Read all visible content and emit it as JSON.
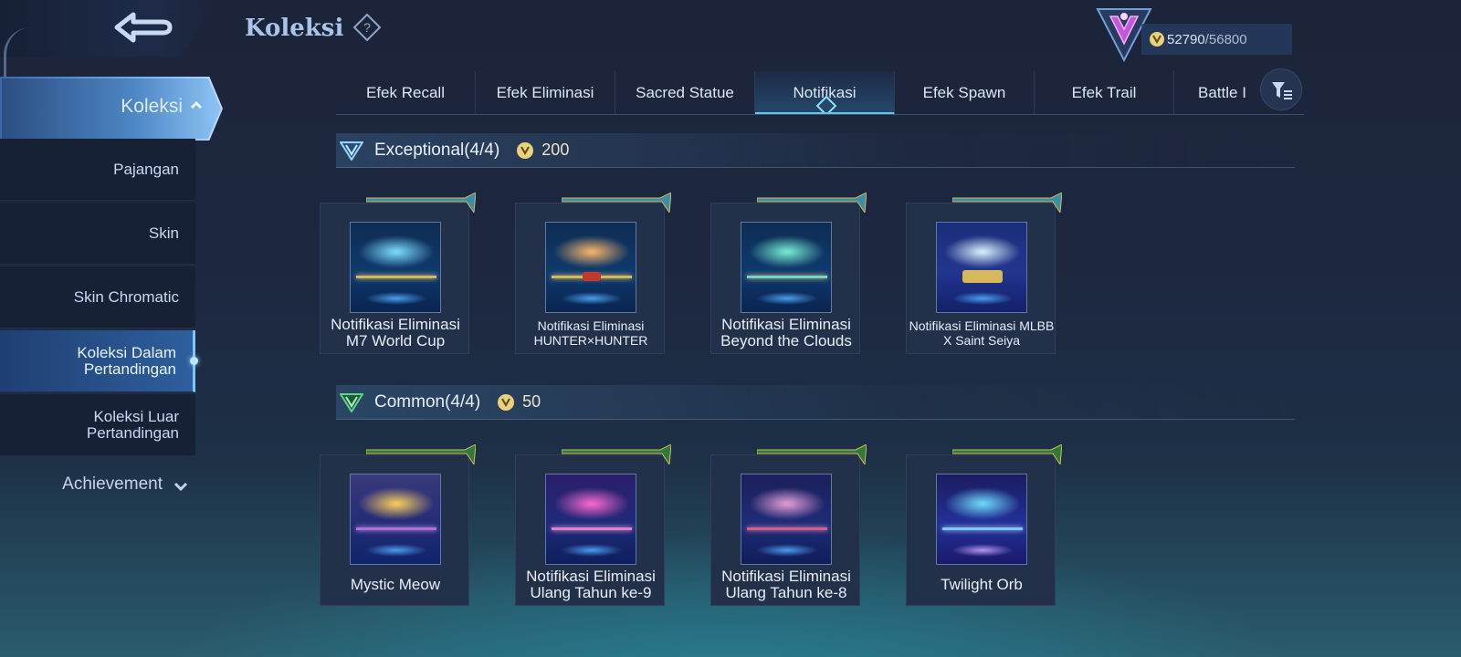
{
  "header": {
    "title": "Koleksi",
    "currency_current": "52790",
    "currency_separator": "/",
    "currency_max": "56800"
  },
  "sidebar": {
    "main_label": "Koleksi",
    "items": [
      {
        "label": "Pajangan"
      },
      {
        "label": "Skin"
      },
      {
        "label": "Skin Chromatic"
      },
      {
        "label": "Koleksi Dalam Pertandingan",
        "active": true
      },
      {
        "label": "Koleksi Luar Pertandingan"
      }
    ],
    "achievement_label": "Achievement"
  },
  "tabs": [
    {
      "label": "Efek Recall"
    },
    {
      "label": "Efek Eliminasi"
    },
    {
      "label": "Sacred Statue"
    },
    {
      "label": "Notifikasi",
      "active": true
    },
    {
      "label": "Efek Spawn"
    },
    {
      "label": "Efek Trail"
    },
    {
      "label": "Battle I"
    }
  ],
  "sections": [
    {
      "title": "Exceptional(4/4)",
      "points": "200",
      "tier_color": "#8fd8ff",
      "items": [
        {
          "name": "Notifikasi Eliminasi M7 World Cup",
          "glow": "#7fe0ff"
        },
        {
          "name": "Notifikasi Eliminasi HUNTER×HUNTER",
          "glow": "#ffb86a"
        },
        {
          "name": "Notifikasi Eliminasi Beyond the Clouds",
          "glow": "#7af0d6"
        },
        {
          "name": "Notifikasi Eliminasi MLBB X Saint Seiya",
          "glow": "#dff4ff"
        }
      ]
    },
    {
      "title": "Common(4/4)",
      "points": "50",
      "tier_color": "#5fd28a",
      "items": [
        {
          "name": "Mystic Meow",
          "glow": "#ffd25a"
        },
        {
          "name": "Notifikasi Eliminasi Ulang Tahun ke-9",
          "glow": "#ff6ad2"
        },
        {
          "name": "Notifikasi Eliminasi Ulang Tahun ke-8",
          "glow": "#e8a0d8"
        },
        {
          "name": "Twilight Orb",
          "glow": "#6fe0ff"
        }
      ]
    }
  ],
  "icons": {
    "back": "back-arrow-icon",
    "help": "help-diamond-icon",
    "rank": "rank-emblem-icon",
    "coin": "coin-icon",
    "filter": "filter-sort-icon",
    "chevron_up": "chevron-up-icon",
    "chevron_down": "chevron-down-icon"
  },
  "colors": {
    "accent": "#62c8f0",
    "gold": "#d7b85a",
    "coin": "#e9d27a"
  }
}
